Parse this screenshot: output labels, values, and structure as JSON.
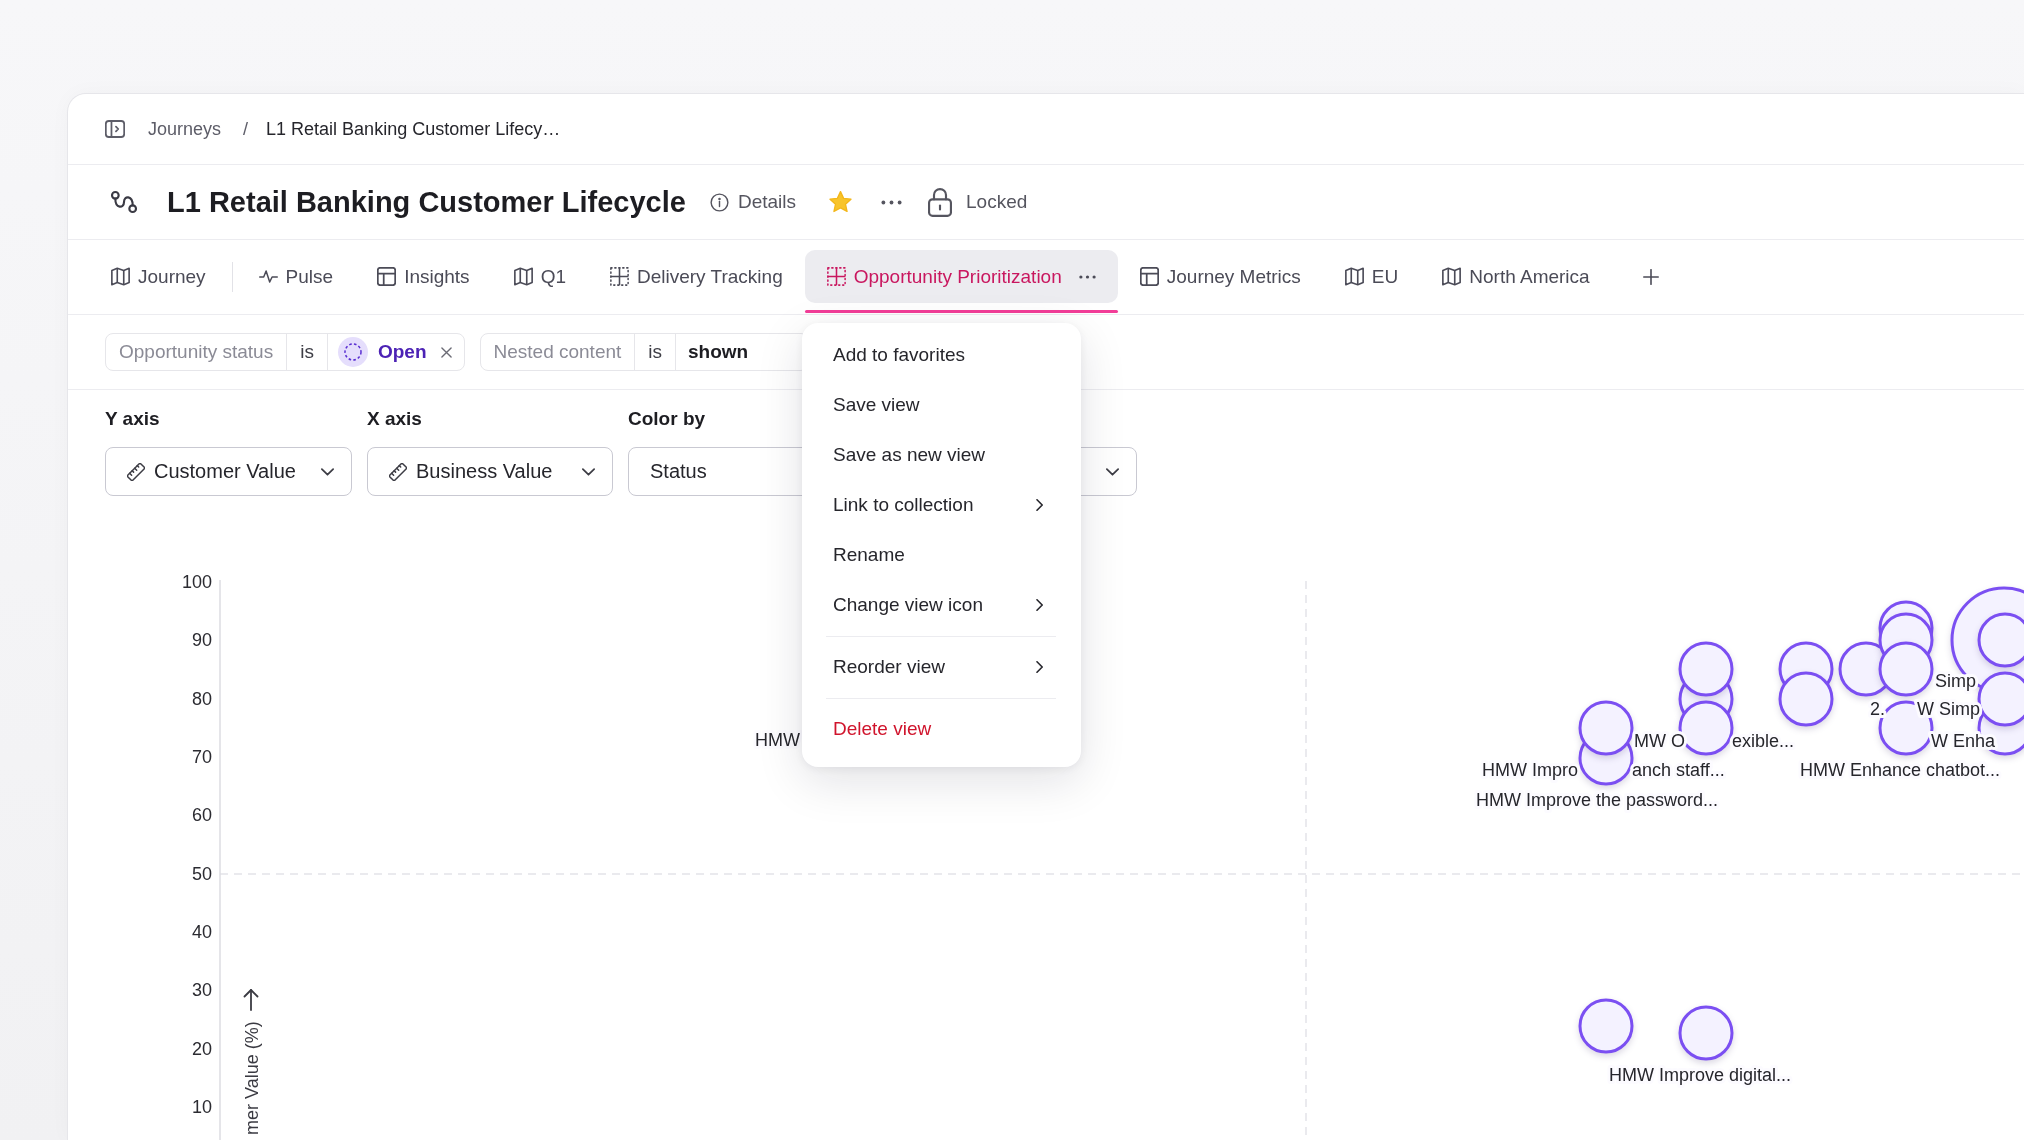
{
  "breadcrumb": {
    "items": [
      {
        "label": "Journeys",
        "current": false
      },
      {
        "label": "L1 Retail Banking Customer Lifecy…",
        "current": true
      }
    ],
    "separator": "/"
  },
  "header": {
    "title": "L1 Retail Banking Customer Lifecycle",
    "details_label": "Details",
    "favorite": true,
    "locked": true,
    "lock_label": "Locked"
  },
  "tabs": [
    {
      "label": "Journey",
      "kind": "map",
      "selected": false
    },
    {
      "label": "Pulse",
      "kind": "pulse",
      "selected": false
    },
    {
      "label": "Insights",
      "kind": "table",
      "selected": false
    },
    {
      "label": "Q1",
      "kind": "map",
      "selected": false
    },
    {
      "label": "Delivery Tracking",
      "kind": "matrix",
      "selected": false
    },
    {
      "label": "Opportunity Prioritization",
      "kind": "matrix",
      "selected": true
    },
    {
      "label": "Journey Metrics",
      "kind": "table",
      "selected": false
    },
    {
      "label": "EU",
      "kind": "map",
      "selected": false
    },
    {
      "label": "North America",
      "kind": "map",
      "selected": false
    }
  ],
  "filters": [
    {
      "field": "Opportunity status",
      "operator": "is",
      "value": "Open",
      "kind": "status",
      "removable": true
    },
    {
      "field": "Nested content",
      "operator": "is",
      "value": "shown",
      "kind": "text",
      "removable": false
    }
  ],
  "axis_controls": [
    {
      "label": "Y axis",
      "value": "Customer Value",
      "kind": "measure"
    },
    {
      "label": "X axis",
      "value": "Business Value",
      "kind": "measure"
    },
    {
      "label": "Color by",
      "value": "Status",
      "kind": "field"
    }
  ],
  "chart": {
    "y_ticks": [
      "100",
      "90",
      "80",
      "70",
      "60",
      "50",
      "40",
      "30",
      "20",
      "10"
    ],
    "y_title": "mer Value (%)",
    "point_labels": [
      "HMW",
      "MW O",
      "exible...",
      "HMW Impro",
      "anch staff...",
      "HMW Improve the password...",
      "Simp",
      "2.",
      "W Simp",
      "W Enha",
      "HMW Enhance chatbot...",
      "HMW Improve digital..."
    ]
  },
  "menu": {
    "groups": [
      [
        {
          "label": "Add to favorites",
          "submenu": false,
          "danger": false
        },
        {
          "label": "Save view",
          "submenu": false,
          "danger": false
        },
        {
          "label": "Save as new view",
          "submenu": false,
          "danger": false
        },
        {
          "label": "Link to collection",
          "submenu": true,
          "danger": false
        },
        {
          "label": "Rename",
          "submenu": false,
          "danger": false
        },
        {
          "label": "Change view icon",
          "submenu": true,
          "danger": false
        }
      ],
      [
        {
          "label": "Reorder view",
          "submenu": true,
          "danger": false
        }
      ],
      [
        {
          "label": "Delete view",
          "submenu": false,
          "danger": true
        }
      ]
    ]
  }
}
